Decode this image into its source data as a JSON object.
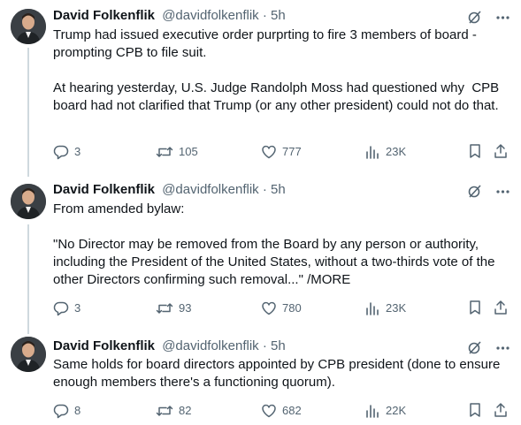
{
  "tweets": [
    {
      "name": "David Folkenflik",
      "handle": "@davidfolkenflik",
      "dot": "·",
      "time": "5h",
      "text": "Trump had issued executive order purprting to fire 3 members of board - prompting CPB to file suit.\n\nAt hearing yesterday, U.S. Judge Randolph Moss had questioned why  CPB board had not clarified that Trump (or any other president) could not do that.",
      "replies": "3",
      "reposts": "105",
      "likes": "777",
      "views": "23K"
    },
    {
      "name": "David Folkenflik",
      "handle": "@davidfolkenflik",
      "dot": "·",
      "time": "5h",
      "text": "From amended bylaw:\n\n\"No Director may be removed from the Board by any person or authority, including the President of the United States, without a two-thirds vote of the other Directors confirming such removal...\" /MORE",
      "replies": "3",
      "reposts": "93",
      "likes": "780",
      "views": "23K"
    },
    {
      "name": "David Folkenflik",
      "handle": "@davidfolkenflik",
      "dot": "·",
      "time": "5h",
      "text": "Same holds for board directors appointed by CPB president (done to ensure enough members there's a functioning quorum).",
      "replies": "8",
      "reposts": "82",
      "likes": "682",
      "views": "22K"
    }
  ]
}
